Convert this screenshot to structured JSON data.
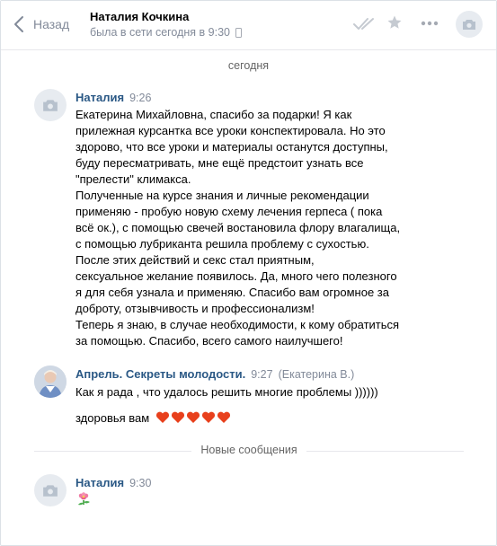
{
  "header": {
    "back_label": "Назад",
    "contact_name": "Наталия Кочкина",
    "status": "была в сети сегодня в 9:30"
  },
  "date_separator": "сегодня",
  "messages": [
    {
      "author": "Наталия",
      "time": "9:26",
      "lines": [
        "Екатерина Михайловна, спасибо за подарки! Я как",
        "прилежная курсантка все уроки конспектировала. Но это",
        "здорово, что все уроки и материалы останутся доступны,",
        "буду пересматривать, мне ещё предстоит узнать все",
        "\"прелести\" климакса.",
        "Полученные на курсе знания и личные рекомендации",
        "применяю - пробую новую схему лечения герпеса ( пока",
        "всё ок.), с помощью свечей востановила флору влагалища,",
        "с помощью лубриканта решила проблему с сухостью.",
        "После этих действий и секс стал приятным,",
        "сексуальное желание появилось. Да, много чего полезного",
        "я для себя узнала и применяю. Спасибо вам огромное за",
        "доброту, отзывчивость и профессионализм!",
        "Теперь я знаю, в случае необходимости, к кому обратиться",
        "за помощью. Спасибо, всего самого наилучшего!"
      ]
    },
    {
      "author": "Апрель. Секреты молодости.",
      "time": "9:27",
      "for_who": "(Екатерина В.)",
      "line1": "Как я рада , что удалось решить многие проблемы ))))))",
      "line2": "здоровья вам"
    },
    {
      "author": "Наталия",
      "time": "9:30"
    }
  ],
  "new_messages_label": "Новые сообщения",
  "colors": {
    "link": "#2a5885",
    "muted": "#828a99",
    "heart": "#e8401c"
  },
  "icons": [
    "chevron-left-icon",
    "phone-icon",
    "double-check-icon",
    "star-icon",
    "more-icon",
    "camera-icon",
    "flower-icon",
    "heart-icon"
  ]
}
